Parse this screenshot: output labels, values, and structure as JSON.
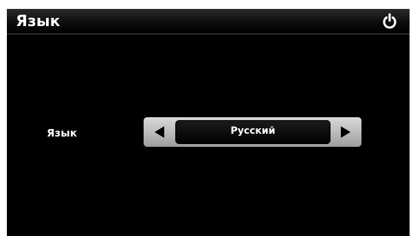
{
  "header": {
    "title": "Язык",
    "power_icon": "power-icon"
  },
  "setting": {
    "label": "Язык",
    "value": "Русский",
    "prev_icon": "triangle-left-icon",
    "next_icon": "triangle-right-icon"
  }
}
